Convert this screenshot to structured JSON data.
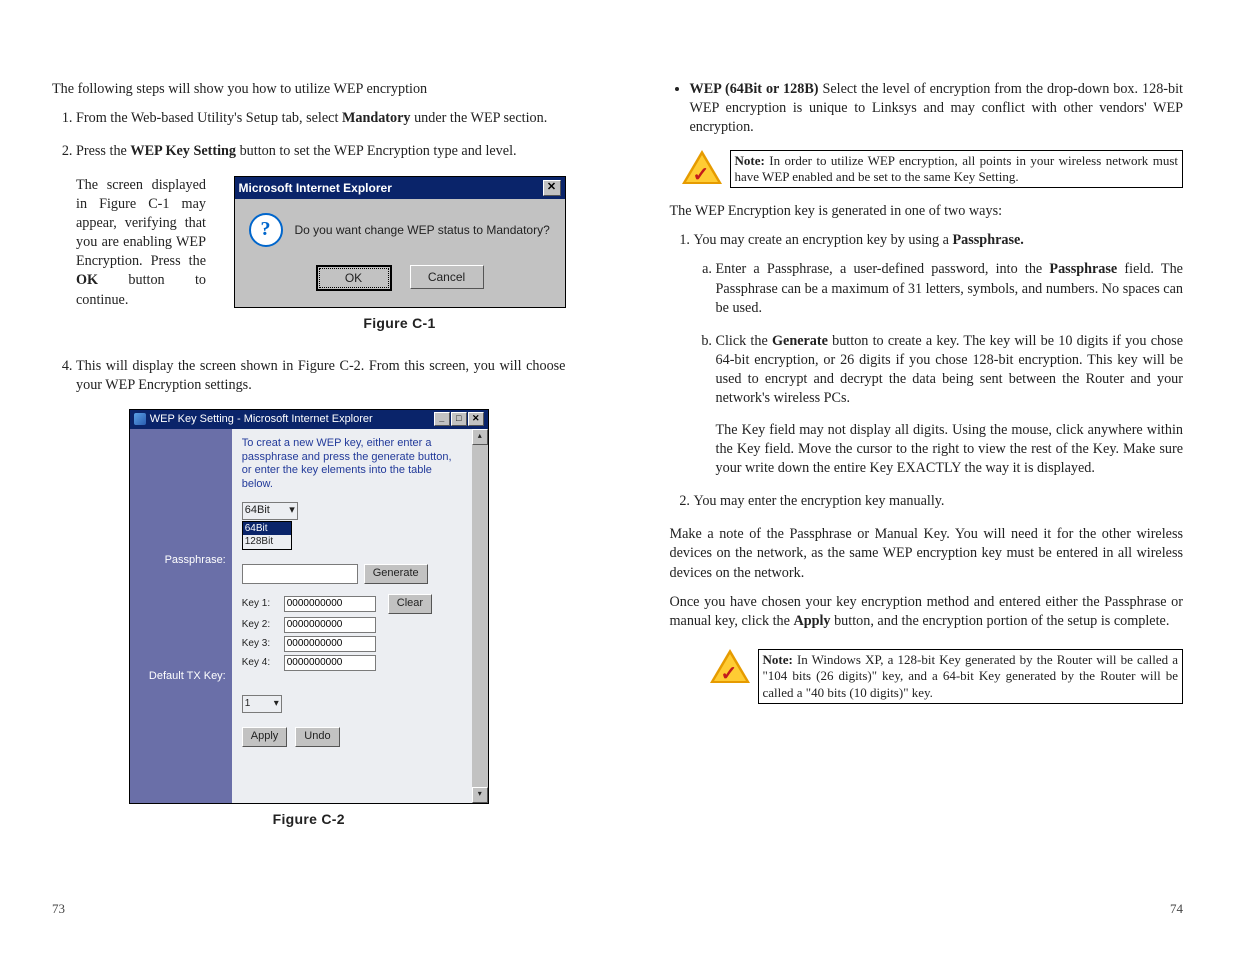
{
  "left": {
    "intro": "The following steps will show you how to utilize WEP encryption",
    "step1_a": "From the Web-based Utility's Setup tab, select ",
    "step1_b": "Mandatory",
    "step1_c": " under the WEP section.",
    "step2_a": "Press the ",
    "step2_b": "WEP Key Setting",
    "step2_c": " button to set the WEP Encryption type and level.",
    "step3_a": "The screen displayed in Figure C-1 may appear, verifying that you are enabling WEP Encryption. Press the ",
    "step3_b": "OK",
    "step3_c": " button to continue.",
    "step4": "This will display the screen shown in Figure C-2. From this screen, you will choose your WEP Encryption settings.",
    "page_num": "73"
  },
  "fig1": {
    "title": "Microsoft Internet Explorer",
    "msg": "Do you want change WEP status to Mandatory?",
    "ok": "OK",
    "cancel": "Cancel",
    "caption": "Figure C-1"
  },
  "fig2": {
    "title": "WEP Key Setting - Microsoft Internet Explorer",
    "instr": "To creat a new WEP key, either enter a passphrase and press the generate button, or enter the key elements into the table below.",
    "bit_selected": "64Bit",
    "opt1": "64Bit",
    "opt2": "128Bit",
    "lbl_pass": "Passphrase:",
    "lbl_tx": "Default TX Key:",
    "gen": "Generate",
    "clear": "Clear",
    "k1": "Key 1:",
    "k2": "Key 2:",
    "k3": "Key 3:",
    "k4": "Key 4:",
    "kv": "0000000000",
    "tx": "1",
    "apply": "Apply",
    "undo": "Undo",
    "caption": "Figure C-2"
  },
  "right": {
    "bullet_a": "WEP (64Bit or 128B)",
    "bullet_b": " Select the level of encryption from the drop-down box.  128-bit WEP encryption is unique to Linksys and may conflict with other vendors' WEP encryption.",
    "note1_a": "Note:",
    "note1_b": " In order to utilize WEP encryption, all points in your wireless network must have WEP enabled and be set to the same Key Setting.",
    "p_ways": "The WEP Encryption key is generated in one of two ways:",
    "s1_a": "You may create an encryption key by using a ",
    "s1_b": "Passphrase.",
    "s1a_a": "Enter a Passphrase, a user-defined password, into the ",
    "s1a_b": "Passphrase",
    "s1a_c": " field. The Passphrase can be a maximum of 31 letters, symbols, and numbers. No spaces can be used.",
    "s1b_a": "Click the ",
    "s1b_b": "Generate",
    "s1b_c": " button to create a key. The key will be 10 digits if you chose 64-bit encryption, or 26 digits if you chose 128-bit encryption. This key will be used to encrypt and decrypt the data being sent between the Router and your network's wireless PCs.",
    "s1b_p2": "The Key field may not display all digits.  Using the mouse, click anywhere within the Key field.  Move the cursor to the right to view the rest of the Key.  Make sure your write down the entire Key EXACTLY the way it is displayed.",
    "s2": "You may enter the encryption key manually.",
    "p_note": "Make a note of the Passphrase or Manual Key.  You will need it for the other wireless devices on the network, as the same WEP encryption key must be entered in all wireless devices on the network.",
    "p_apply_a": "Once you have chosen your key encryption method and entered either the Passphrase or manual key, click the ",
    "p_apply_b": "Apply",
    "p_apply_c": " button, and the encryption portion of the setup is complete.",
    "note2_a": "Note:",
    "note2_b": " In Windows XP, a 128-bit Key generated by the Router will be called a \"104 bits (26 digits)\" key, and a 64-bit Key generated by the Router will be called a \"40 bits (10 digits)\" key.",
    "page_num": "74"
  }
}
